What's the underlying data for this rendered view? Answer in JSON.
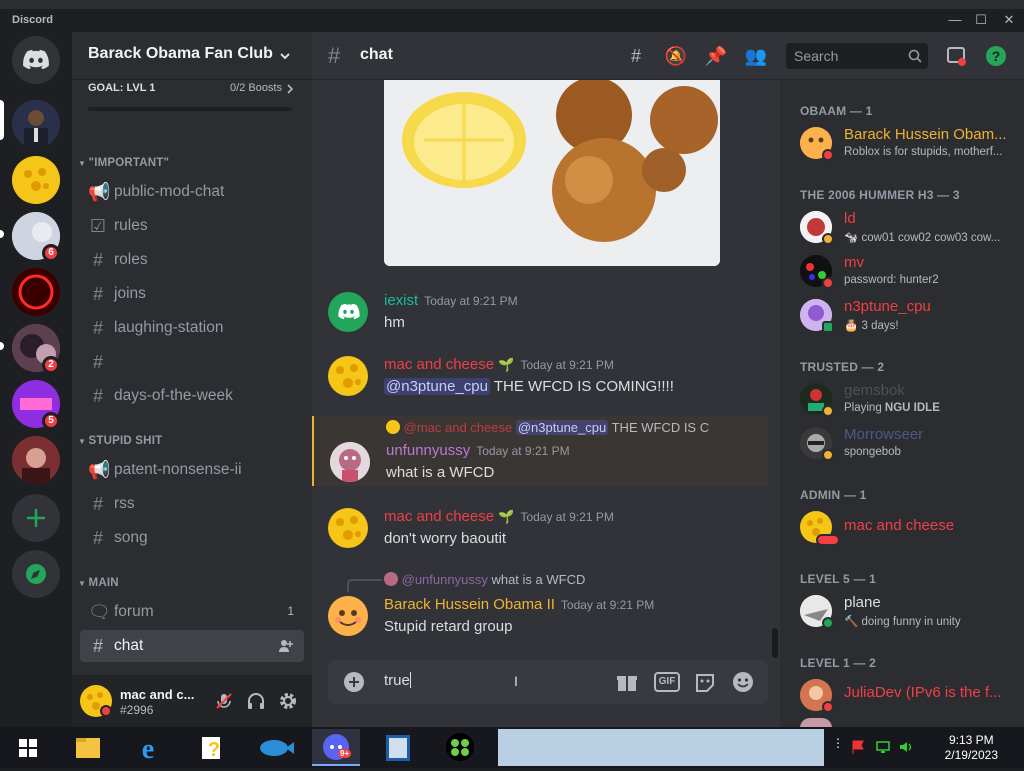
{
  "window": {
    "app_name": "Discord",
    "minimize": "—",
    "maximize": "☐",
    "close": "✕"
  },
  "server_badges": [
    "6",
    "2",
    "5"
  ],
  "guild": {
    "name": "Barack Obama Fan Club",
    "goal_label": "GOAL: LVL 1",
    "boosts": "0/2 Boosts"
  },
  "categories": {
    "important": "\"IMPORTANT\"",
    "stupid": "STUPID SHIT",
    "main": "MAIN"
  },
  "channels": {
    "public_mod_chat": "public-mod-chat",
    "rules": "rules",
    "roles": "roles",
    "joins": "joins",
    "laughing_station": "laughing-station",
    "blank": "",
    "days_of_the_week": "days-of-the-week",
    "patent_nonsense": "patent-nonsense-ii",
    "rss": "rss",
    "song": "song",
    "forum": "forum",
    "forum_count": "1",
    "chat": "chat"
  },
  "user_panel": {
    "name": "mac and c...",
    "tag": "#2996"
  },
  "header": {
    "channel": "chat",
    "search_placeholder": "Search"
  },
  "messages": [
    {
      "author": "iexist",
      "time": "Today at 9:21 PM",
      "text": "hm"
    },
    {
      "author": "mac and cheese",
      "time": "Today at 9:21 PM",
      "mention": "@n3ptune_cpu",
      "text": " THE WFCD IS COMING!!!!"
    },
    {
      "reply_author": "@mac and cheese",
      "reply_mention": "@n3ptune_cpu",
      "reply_text": " THE WFCD IS C",
      "author": "unfunnyussy",
      "time": "Today at 9:21 PM",
      "text": "what is a WFCD"
    },
    {
      "author": "mac and cheese",
      "time": "Today at 9:21 PM",
      "text": "don't worry baoutit"
    },
    {
      "reply_author": "@unfunnyussy",
      "reply_text": "what is a WFCD",
      "author": "Barack Hussein Obama II",
      "time": "Today at 9:21 PM",
      "text": "Stupid retard group"
    }
  ],
  "composer": {
    "value": "true",
    "gif": "GIF"
  },
  "members": {
    "obaam_header": "OBAAM — 1",
    "obaam": [
      {
        "name": "Barack Hussein Obam...",
        "status": "Roblox is for stupids, motherf..."
      }
    ],
    "hummer_header": "THE 2006 HUMMER H3 — 3",
    "hummer": [
      {
        "name": "ld",
        "status": "cow01 cow02 cow03 cow..."
      },
      {
        "name": "mv",
        "status": "password: hunter2"
      },
      {
        "name": "n3ptune_cpu",
        "status": "3 days!"
      }
    ],
    "trusted_header": "TRUSTED — 2",
    "trusted": [
      {
        "name": "gemsbok",
        "status_prefix": "Playing ",
        "status": "NGU IDLE"
      },
      {
        "name": "Morrowseer",
        "status": "spongebob"
      }
    ],
    "admin_header": "ADMIN — 1",
    "admin": [
      {
        "name": "mac and cheese"
      }
    ],
    "level5_header": "LEVEL 5 — 1",
    "level5": [
      {
        "name": "plane",
        "status": "doing funny in unity"
      }
    ],
    "level1_header": "LEVEL 1 — 2",
    "level1": [
      {
        "name": "JuliaDev (IPv6 is the f...",
        "status": ""
      }
    ]
  },
  "taskbar": {
    "time": "9:13 PM",
    "date": "2/19/2023",
    "discord_badge": "9+"
  },
  "colors": {
    "bg_server": "#1e1f22",
    "bg_channels": "#2b2d31",
    "bg_chat": "#313338",
    "green": "#23a55a",
    "red": "#f23f43",
    "blurple": "#5865f2"
  }
}
